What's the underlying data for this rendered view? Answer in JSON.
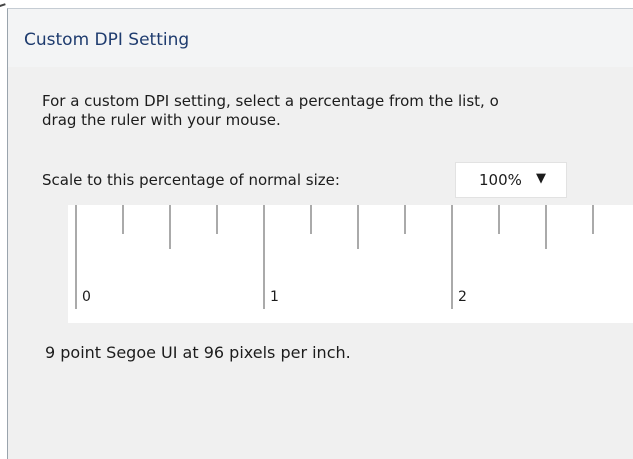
{
  "dialog": {
    "title": "Custom DPI Setting",
    "description_line1": "For a custom DPI setting, select a percentage from the list, o",
    "description_line2": "drag the ruler with your mouse.",
    "scale_label": "Scale to this percentage of normal size:",
    "scale_value": "100%",
    "dropdown_icon": "triangle-down",
    "ruler": {
      "labels": [
        "0",
        "1",
        "2"
      ]
    },
    "font_info": "9 point Segoe UI at 96 pixels per inch."
  }
}
